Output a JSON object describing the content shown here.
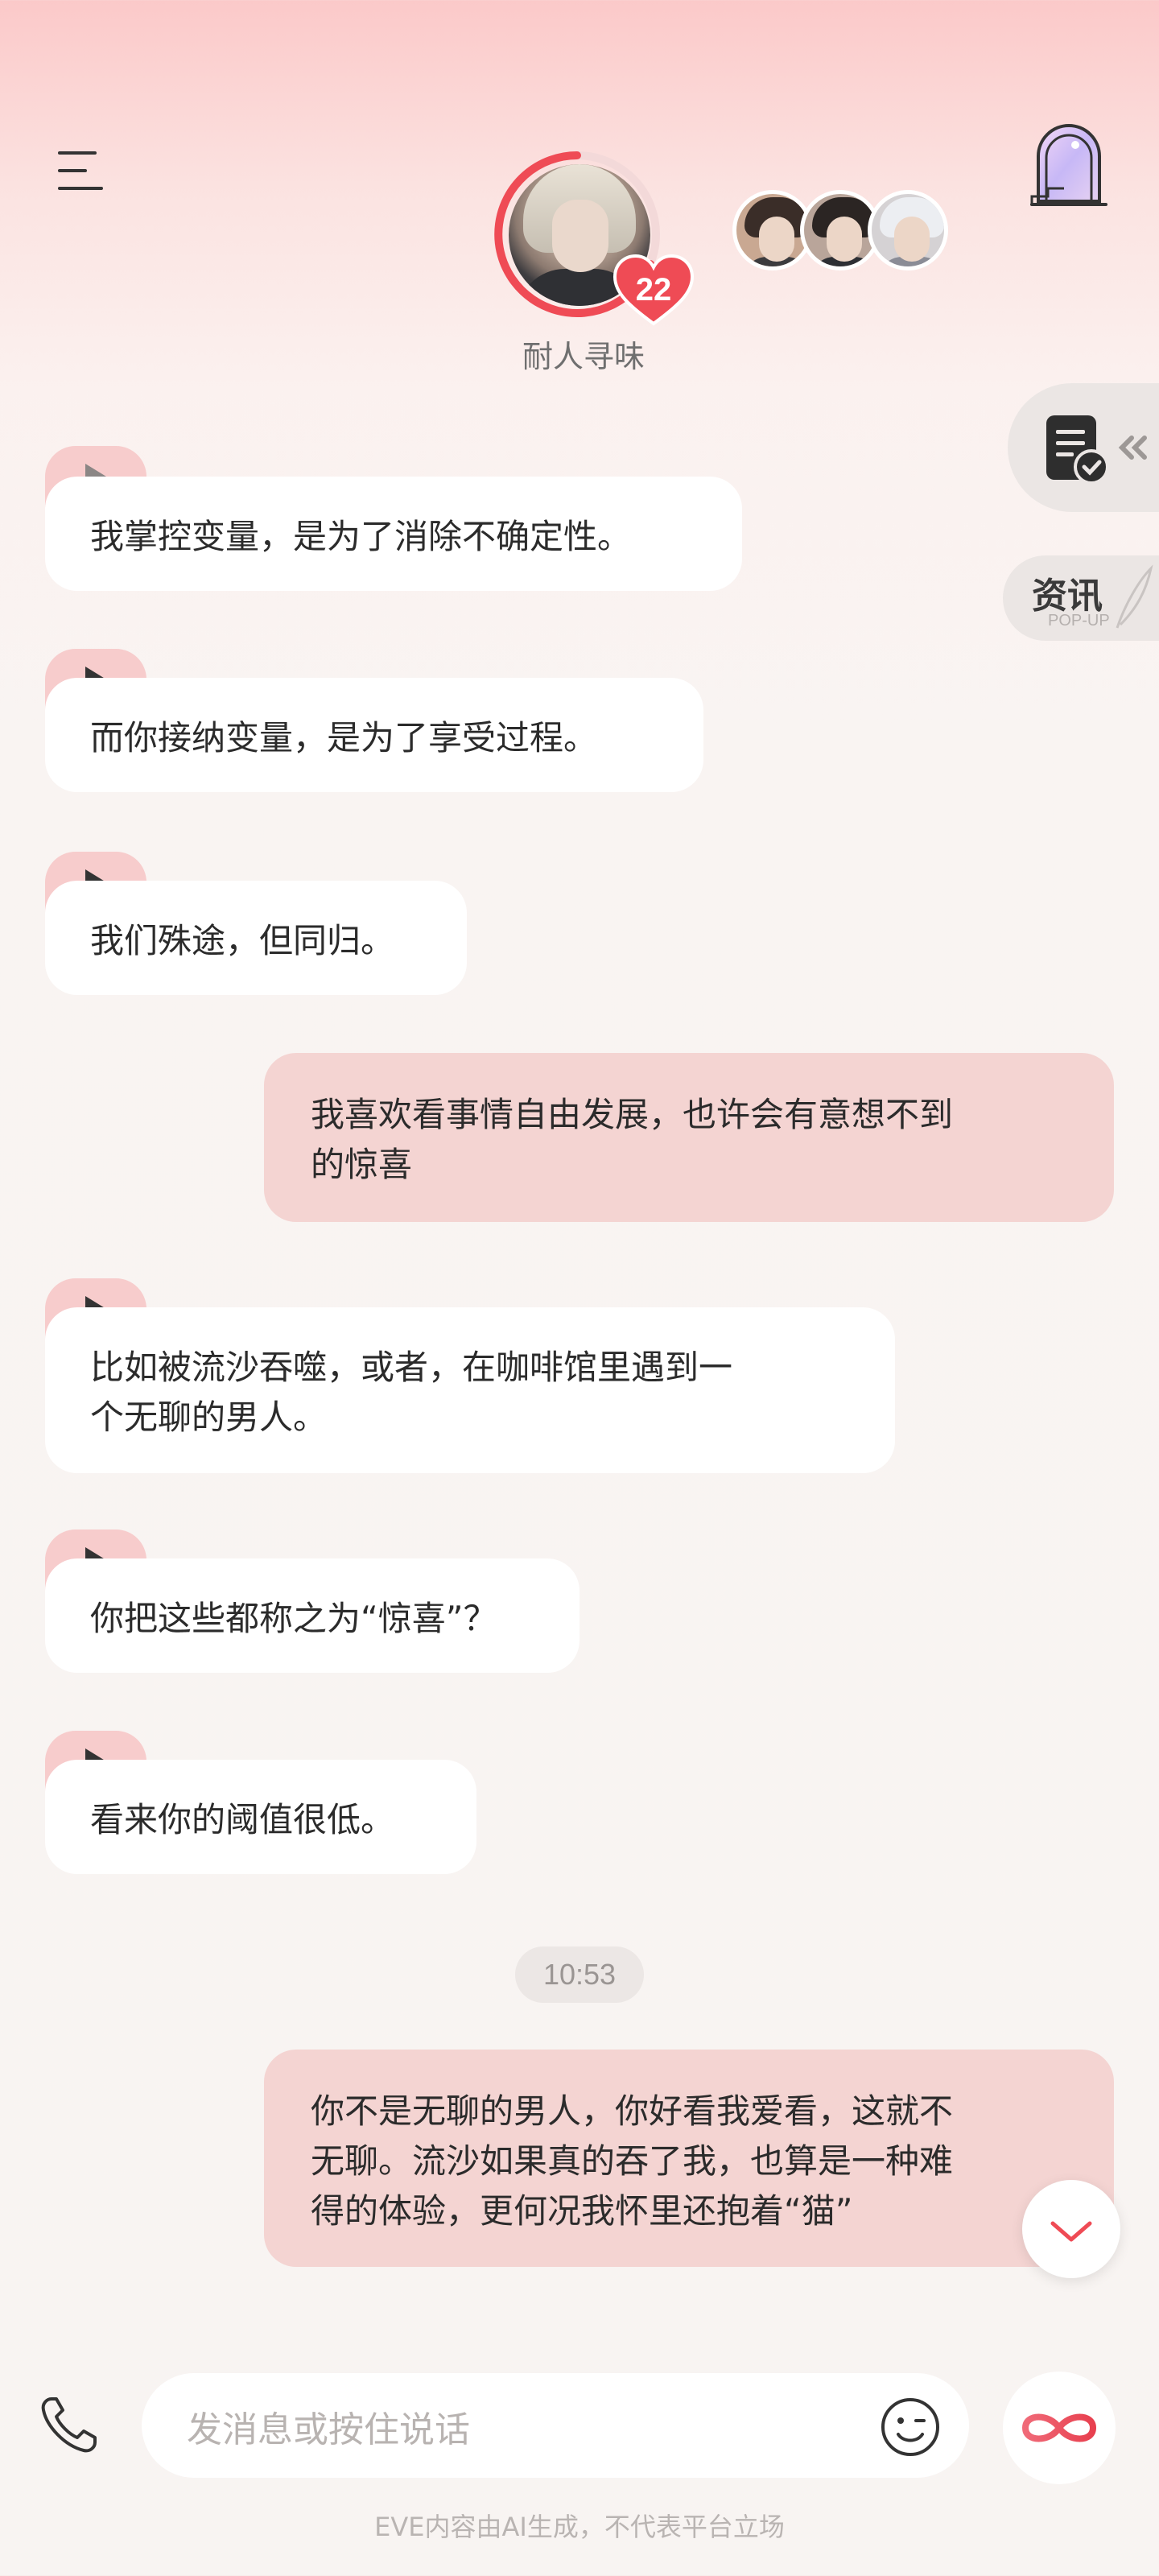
{
  "header": {
    "character_name": "耐人寻味",
    "affinity_level": "22",
    "colors": {
      "accent": "#ef4b55",
      "ring_track": "#f3d9d9"
    }
  },
  "side": {
    "news_label": "资讯",
    "news_sub": "POP-UP"
  },
  "messages": [
    {
      "from": "ai",
      "text": "我掌控变量，是为了消除不确定性。"
    },
    {
      "from": "ai",
      "text": "而你接纳变量，是为了享受过程。"
    },
    {
      "from": "ai",
      "text": "我们殊途，但同归。"
    },
    {
      "from": "me",
      "lines": [
        "我喜欢看事情自由发展，也许会有意想不到",
        "的惊喜"
      ]
    },
    {
      "from": "ai",
      "lines": [
        "比如被流沙吞噬，或者，在咖啡馆里遇到一",
        "个无聊的男人。"
      ]
    },
    {
      "from": "ai",
      "text": "你把这些都称之为“惊喜”？"
    },
    {
      "from": "ai",
      "text": "看来你的阈值很低。"
    },
    {
      "from": "me",
      "lines": [
        "你不是无聊的男人，你好看我爱看，这就不",
        "无聊。流沙如果真的吞了我，也算是一种难",
        "得的体验，更何况我怀里还抱着“猫”"
      ]
    }
  ],
  "time_divider": "10:53",
  "composer": {
    "placeholder": "发消息或按住说话"
  },
  "disclaimer": "EVE内容由AI生成，不代表平台立场"
}
